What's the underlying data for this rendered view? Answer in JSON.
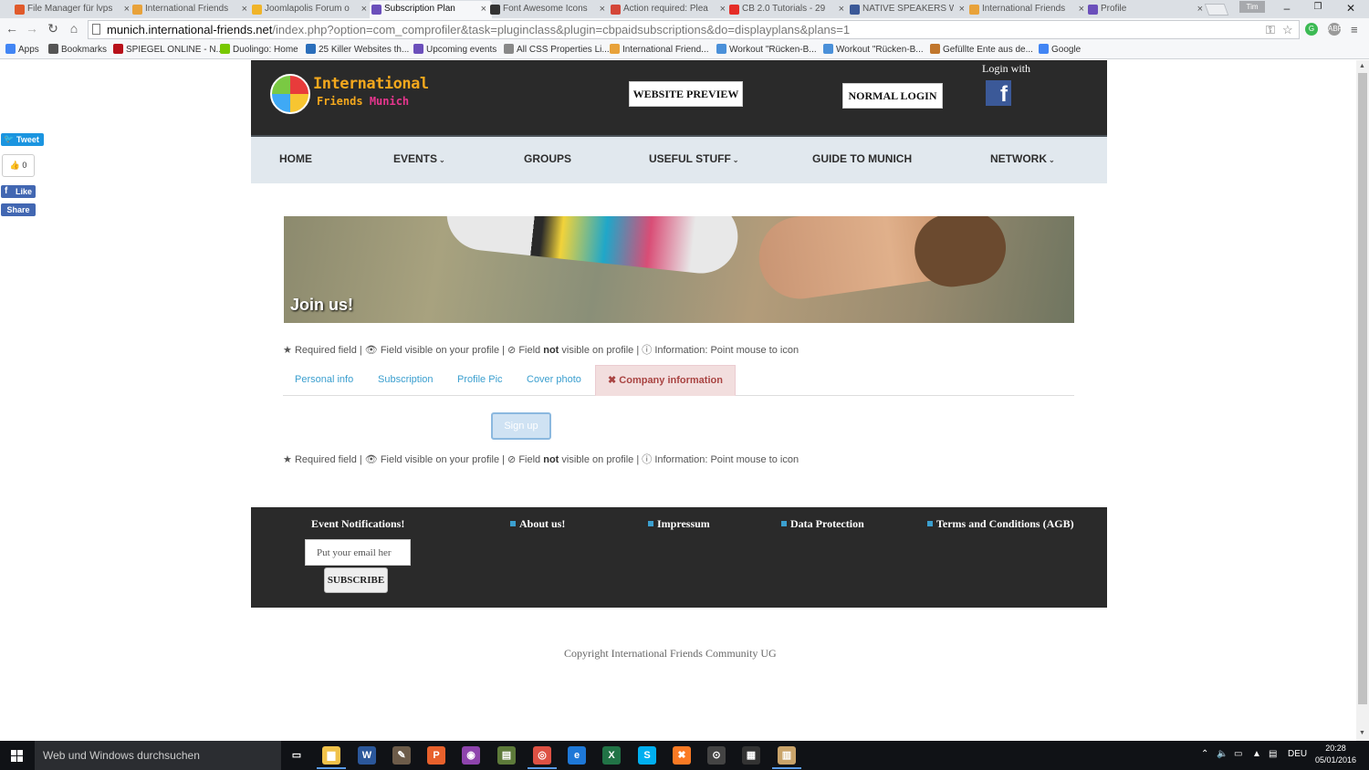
{
  "browser": {
    "tabs": [
      {
        "label": "File Manager für lvps",
        "color": "#e05a2b"
      },
      {
        "label": "International Friends",
        "color": "#e8a23a"
      },
      {
        "label": "Joomlapolis Forum o",
        "color": "#f0b429"
      },
      {
        "label": "Subscription Plan",
        "color": "#6b4fbb",
        "active": true
      },
      {
        "label": "Font Awesome Icons",
        "color": "#333333"
      },
      {
        "label": "Action required: Plea",
        "color": "#d44638"
      },
      {
        "label": "CB 2.0 Tutorials - 29",
        "color": "#e52d27"
      },
      {
        "label": "NATIVE SPEAKERS W",
        "color": "#3b5998"
      },
      {
        "label": "International Friends",
        "color": "#e8a23a"
      },
      {
        "label": "Profile",
        "color": "#6b4fbb"
      }
    ],
    "url_host": "munich.international-friends.net",
    "url_path": "/index.php?option=com_comprofiler&task=pluginclass&plugin=cbpaidsubscriptions&do=displayplans&plans=1",
    "bookmarks": [
      {
        "label": "Apps",
        "color": "#4285f4"
      },
      {
        "label": "Bookmarks",
        "color": "#555555"
      },
      {
        "label": "SPIEGEL ONLINE - N...",
        "color": "#b8111a"
      },
      {
        "label": "Duolingo: Home",
        "color": "#78c800"
      },
      {
        "label": "25 Killer Websites th...",
        "color": "#2a6ebb"
      },
      {
        "label": "Upcoming events",
        "color": "#6b4fbb"
      },
      {
        "label": "All CSS Properties Li...",
        "color": "#888888"
      },
      {
        "label": "International Friend...",
        "color": "#e8a23a"
      },
      {
        "label": "Workout \"Rücken-B...",
        "color": "#4a90d9"
      },
      {
        "label": "Workout \"Rücken-B...",
        "color": "#4a90d9"
      },
      {
        "label": "Gefüllte Ente aus de...",
        "color": "#c0762c"
      },
      {
        "label": "Google",
        "color": "#4285f4"
      }
    ],
    "win_user": "Tim",
    "win_controls": [
      "–",
      "❐",
      "✕"
    ]
  },
  "social": {
    "tweet": "Tweet",
    "vote_count": "0",
    "like": "Like",
    "share": "Share"
  },
  "header": {
    "logo_line1": "International",
    "logo_line2a": "Friends",
    "logo_line2b": "Munich",
    "website_preview": "WEBSITE PREVIEW",
    "normal_login": "NORMAL LOGIN",
    "login_with": "Login with",
    "fb_letter": "f"
  },
  "nav": [
    {
      "label": "HOME",
      "dropdown": false
    },
    {
      "label": "EVENTS",
      "dropdown": true
    },
    {
      "label": "GROUPS",
      "dropdown": false
    },
    {
      "label": "USEFUL STUFF",
      "dropdown": true
    },
    {
      "label": "GUIDE TO MUNICH",
      "dropdown": false
    },
    {
      "label": "NETWORK",
      "dropdown": true
    }
  ],
  "banner": {
    "title": "Join us!"
  },
  "legend": {
    "required": "Required field |",
    "visible": "Field visible on your profile |",
    "field": "Field",
    "not": "not",
    "not_visible_rest": "visible on profile |",
    "info": "Information: Point mouse to icon"
  },
  "profile_tabs": [
    {
      "label": "Personal info"
    },
    {
      "label": "Subscription"
    },
    {
      "label": "Profile Pic"
    },
    {
      "label": "Cover photo"
    },
    {
      "label": "Company information",
      "active": true
    }
  ],
  "signup_label": "Sign up",
  "footer": {
    "notifications_title": "Event Notifications!",
    "email_placeholder": "Put your email her",
    "subscribe": "SUBSCRIBE",
    "links": [
      "About us!",
      "Impressum",
      "Data Protection",
      "Terms and Conditions (AGB)"
    ]
  },
  "copyright": "Copyright International Friends Community UG",
  "taskbar": {
    "search_placeholder": "Web und Windows durchsuchen",
    "apps": [
      {
        "name": "task-view",
        "glyph": "▭",
        "color": "#101216"
      },
      {
        "name": "explorer",
        "glyph": "▆",
        "color": "#f0c24b"
      },
      {
        "name": "word",
        "glyph": "W",
        "color": "#2b579a"
      },
      {
        "name": "gimp",
        "glyph": "✎",
        "color": "#6d5c4a"
      },
      {
        "name": "paint",
        "glyph": "P",
        "color": "#e8612c"
      },
      {
        "name": "picasa",
        "glyph": "◉",
        "color": "#8e44ad"
      },
      {
        "name": "scanner",
        "glyph": "▤",
        "color": "#5d7a3a"
      },
      {
        "name": "chrome",
        "glyph": "◎",
        "color": "#dd5144"
      },
      {
        "name": "edge",
        "glyph": "e",
        "color": "#1e78d7"
      },
      {
        "name": "excel",
        "glyph": "X",
        "color": "#217346"
      },
      {
        "name": "skype",
        "glyph": "S",
        "color": "#00aff0"
      },
      {
        "name": "xampp",
        "glyph": "✖",
        "color": "#fb7a24"
      },
      {
        "name": "media",
        "glyph": "⊙",
        "color": "#444444"
      },
      {
        "name": "calculator",
        "glyph": "▦",
        "color": "#333333"
      },
      {
        "name": "notepad",
        "glyph": "▥",
        "color": "#c9a36a"
      }
    ],
    "lang": "DEU",
    "time": "20:28",
    "date": "05/01/2016"
  }
}
